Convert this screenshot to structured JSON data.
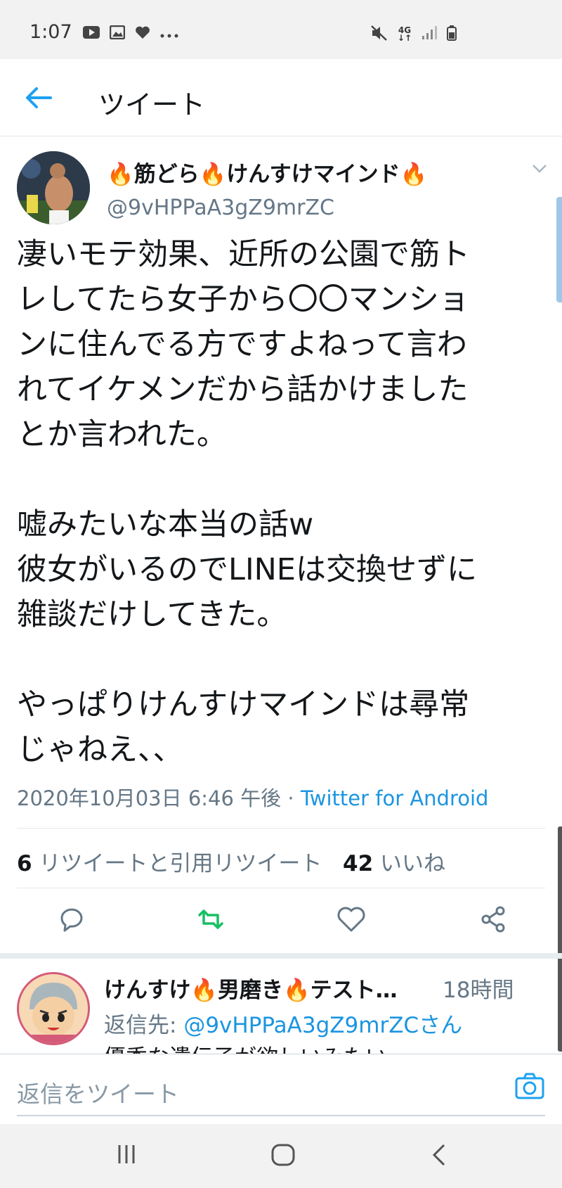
{
  "status_bar": {
    "time": "1:07",
    "network": "4G",
    "icons": [
      "youtube-icon",
      "gallery-icon",
      "heart-icon",
      "more-dots-icon",
      "mute-icon",
      "signal-icon",
      "battery-icon"
    ]
  },
  "header": {
    "title": "ツイート",
    "back_icon": "arrow-left-icon"
  },
  "tweet": {
    "display_name": "🔥筋どら🔥けんすけマインド🔥",
    "handle": "@9vHPPaA3gZ9mrZC",
    "paragraphs": [
      "凄いモテ効果、近所の公園で筋ト\nレしてたら女子から〇〇マンショ\nンに住んでる方ですよねって言わ\nれてイケメンだから話かけました\nとか言われた。",
      "嘘みたいな本当の話w\n彼女がいるのでLINEは交換せずに\n雑談だけしてきた。",
      "やっぱりけんすけマインドは尋常\nじゃねえ、、"
    ],
    "timestamp": "2020年10月03日 6:46 午後",
    "separator": " · ",
    "source": "Twitter for Android",
    "retweet_count": "6",
    "retweet_label": "リツイートと引用リツイート",
    "like_count": "42",
    "like_label": "いいね"
  },
  "actions": [
    "reply-icon",
    "retweet-icon",
    "like-icon",
    "share-icon"
  ],
  "reply": {
    "name": "けんすけ🔥男磨き🔥テスト…",
    "time": "18時間",
    "reply_to_prefix": "返信先: ",
    "reply_to_handle": "@9vHPPaA3gZ9mrZCさん",
    "text": "優秀な遺伝子が欲しいみたい"
  },
  "composer": {
    "placeholder": "返信をツイート"
  },
  "colors": {
    "accent": "#1b95e0",
    "retweet": "#17bf63",
    "text": "#14171a",
    "muted": "#657786"
  }
}
